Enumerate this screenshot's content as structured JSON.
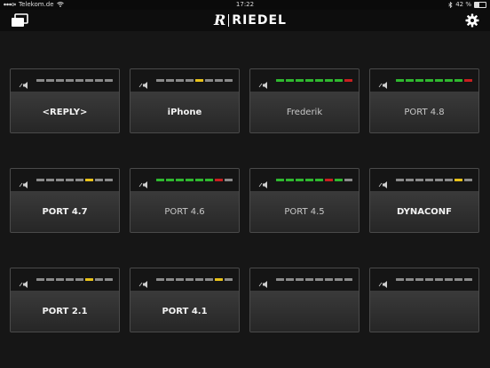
{
  "status": {
    "carrier": "Telekom.de",
    "time": "17:22",
    "battery": "42 %"
  },
  "header": {
    "logo_mark": "R",
    "logo_text": "RIEDEL"
  },
  "icons": {
    "windows": "windows-icon",
    "settings": "gear-icon",
    "speaker": "speaker-icon"
  },
  "colors": {
    "meter_off": "#8a8a8a",
    "meter_green": "#2fb82f",
    "meter_red": "#c82020",
    "meter_yellow": "#e8c21a"
  },
  "keys": [
    {
      "label": "<REPLY>",
      "meter": [
        "off",
        "off",
        "off",
        "off",
        "off",
        "off",
        "off",
        "off"
      ],
      "style": "bold"
    },
    {
      "label": "iPhone",
      "meter": [
        "off",
        "off",
        "off",
        "off",
        "yellow",
        "off",
        "off",
        "off"
      ],
      "style": "bold"
    },
    {
      "label": "Frederik",
      "meter": [
        "green",
        "green",
        "green",
        "green",
        "green",
        "green",
        "green",
        "red"
      ],
      "style": "dim"
    },
    {
      "label": "PORT 4.8",
      "meter": [
        "green",
        "green",
        "green",
        "green",
        "green",
        "green",
        "green",
        "red"
      ],
      "style": "dim"
    },
    {
      "label": "PORT 4.7",
      "meter": [
        "off",
        "off",
        "off",
        "off",
        "off",
        "yellow",
        "off",
        "off"
      ],
      "style": "bold"
    },
    {
      "label": "PORT 4.6",
      "meter": [
        "green",
        "green",
        "green",
        "green",
        "green",
        "green",
        "red",
        "off"
      ],
      "style": "dim"
    },
    {
      "label": "PORT 4.5",
      "meter": [
        "green",
        "green",
        "green",
        "green",
        "green",
        "red",
        "green",
        "off"
      ],
      "style": "dim"
    },
    {
      "label": "DYNACONF",
      "meter": [
        "off",
        "off",
        "off",
        "off",
        "off",
        "off",
        "yellow",
        "off"
      ],
      "style": "bold"
    },
    {
      "label": "PORT 2.1",
      "meter": [
        "off",
        "off",
        "off",
        "off",
        "off",
        "yellow",
        "off",
        "off"
      ],
      "style": "bold"
    },
    {
      "label": "PORT 4.1",
      "meter": [
        "off",
        "off",
        "off",
        "off",
        "off",
        "off",
        "yellow",
        "off"
      ],
      "style": "bold"
    },
    {
      "label": "",
      "meter": [
        "off",
        "off",
        "off",
        "off",
        "off",
        "off",
        "off",
        "off"
      ],
      "style": "bold"
    },
    {
      "label": "",
      "meter": [
        "off",
        "off",
        "off",
        "off",
        "off",
        "off",
        "off",
        "off"
      ],
      "style": "bold"
    }
  ]
}
